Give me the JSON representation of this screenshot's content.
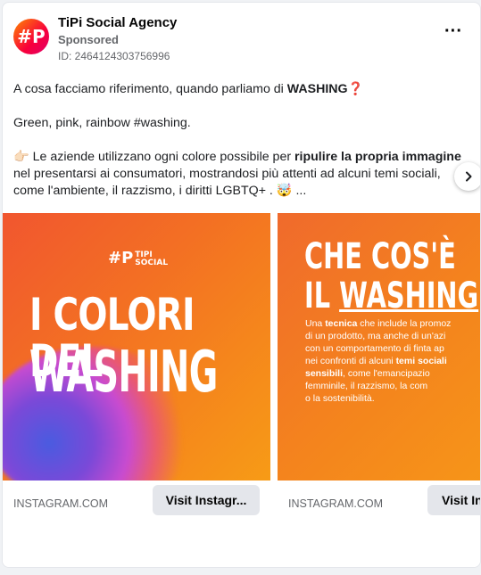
{
  "header": {
    "avatar_text": "#P",
    "page_name": "TiPi Social Agency",
    "sponsored": "Sponsored",
    "ad_id": "ID: 2464124303756996",
    "more_label": "···"
  },
  "post": {
    "line1": "A cosa facciamo riferimento, quando parliamo di ",
    "line1_bold": "WASHING",
    "line1_icon": "❓",
    "line2": "Green, pink, rainbow #washing.",
    "line3_icon": "👉🏻",
    "line3_a": " Le aziende utilizzano ogni colore possibile per ",
    "line3_bold": "ripulire la propria immagine",
    "line3_b": " nel presentarsi ai consumatori, mostrandosi più attenti ad alcuni temi sociali, come l'ambiente, il razzismo, i diritti LGBTQ+ . ",
    "line3_face": "🤯",
    "line3_more": " ..."
  },
  "slides": [
    {
      "logo_mark": "#P",
      "logo_text_1": "TIPI",
      "logo_text_2": "SOCIAL",
      "title_line1": "I COLORI DEL",
      "title_line2": "WASHING",
      "domain": "INSTAGRAM.COM",
      "cta": "Visit Instagr..."
    },
    {
      "title_line1": "CHE COS'È",
      "title_line2_a": "IL ",
      "title_line2_u": "WASHING",
      "title_line2_b": " ?",
      "body_lines": [
        [
          "Una ",
          "tecnica",
          " che include la promoz"
        ],
        [
          "di un prodotto, ma anche di un'azi",
          "",
          ""
        ],
        [
          "con un comportamento di finta ap",
          "",
          ""
        ],
        [
          "nei confronti di alcuni ",
          "temi sociali",
          ""
        ],
        [
          "",
          "sensibili",
          ", come l'emancipazio"
        ],
        [
          "femminile, il razzismo, la com",
          "",
          ""
        ],
        [
          "o la sostenibilità.",
          "",
          ""
        ]
      ],
      "domain": "INSTAGRAM.COM",
      "cta": "Visit Ins"
    }
  ],
  "carousel": {
    "next_icon": "chevron-right-icon"
  },
  "colors": {
    "brand_orange": "#f37023",
    "brand_red": "#f8003b"
  }
}
